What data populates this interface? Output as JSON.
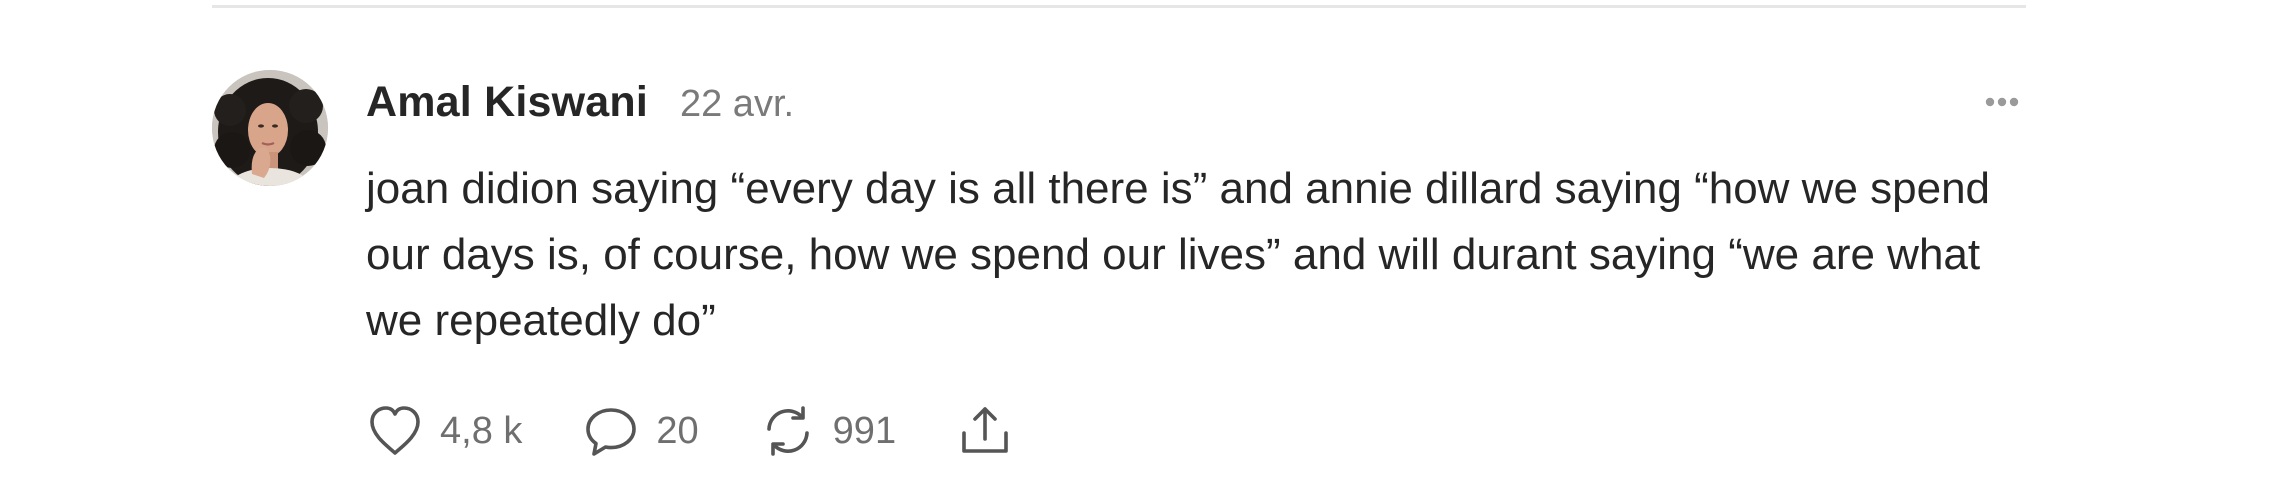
{
  "post": {
    "author": "Amal Kiswani",
    "date": "22 avr.",
    "text": "joan didion saying “every day is all there is” and annie dillard saying “how we spend our days is, of course, how we spend our lives” and will durant saying “we are what we repeatedly do”",
    "likes": "4,8 k",
    "comments": "20",
    "reposts": "991"
  },
  "icons": {
    "more": "more-horizontal-icon",
    "like": "heart-icon",
    "comment": "comment-icon",
    "repost": "repost-icon",
    "share": "share-icon"
  },
  "colors": {
    "text": "#262626",
    "muted": "#7a7a7a",
    "icon": "#555555",
    "divider": "#e6e6e6"
  }
}
